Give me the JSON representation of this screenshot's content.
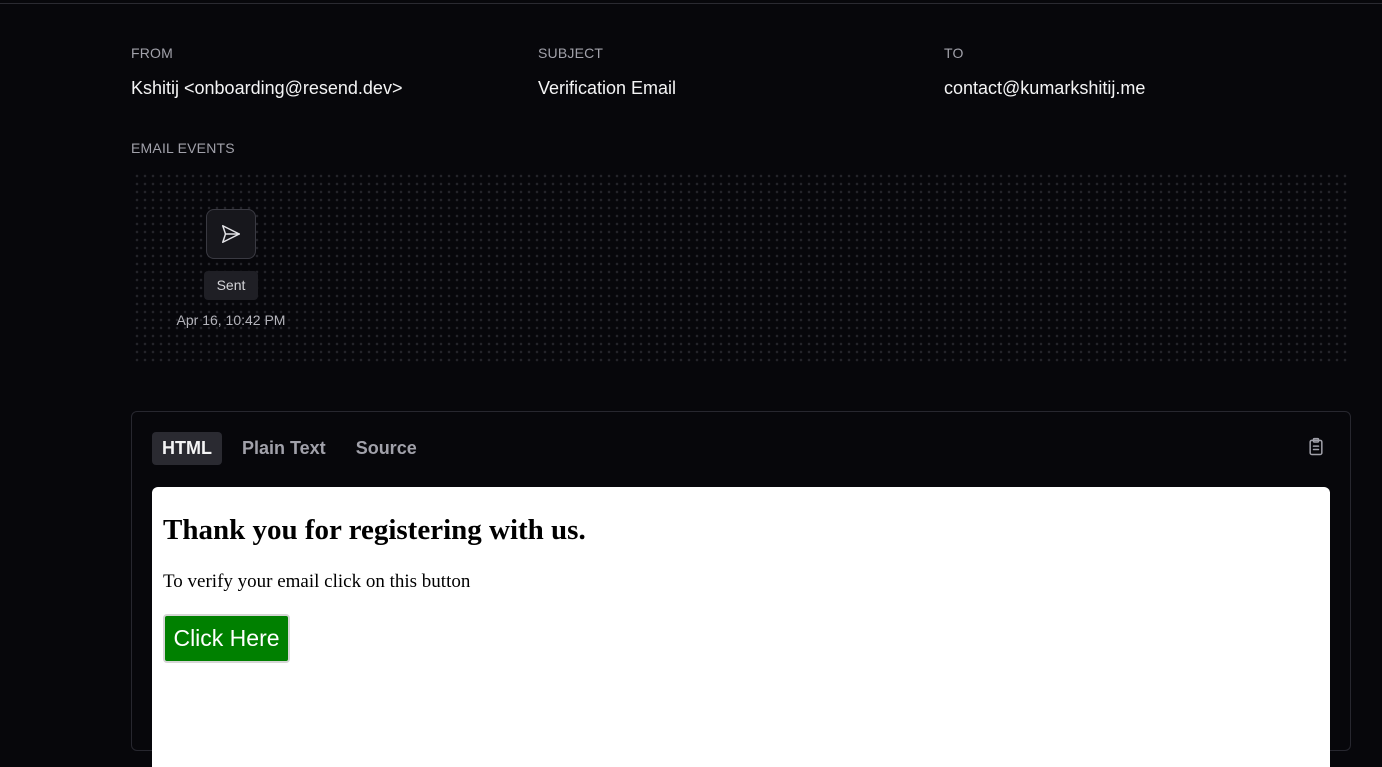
{
  "header": {
    "from_label": "FROM",
    "from_value": "Kshitij <onboarding@resend.dev>",
    "subject_label": "SUBJECT",
    "subject_value": "Verification Email",
    "to_label": "TO",
    "to_value": "contact@kumarkshitij.me"
  },
  "events": {
    "section_label": "EMAIL EVENTS",
    "items": [
      {
        "icon": "send-icon",
        "status": "Sent",
        "timestamp": "Apr 16, 10:42 PM"
      }
    ]
  },
  "preview": {
    "tabs": [
      {
        "label": "HTML",
        "active": true
      },
      {
        "label": "Plain Text",
        "active": false
      },
      {
        "label": "Source",
        "active": false
      }
    ],
    "copy_icon": "clipboard-icon",
    "email": {
      "heading": "Thank you for registering with us.",
      "body": "To verify your email click on this button",
      "button_label": "Click Here",
      "button_color": "#008000"
    }
  },
  "colors": {
    "background": "#07070b",
    "muted_text": "#a1a1aa",
    "active_tab_bg": "#2a2a31"
  }
}
